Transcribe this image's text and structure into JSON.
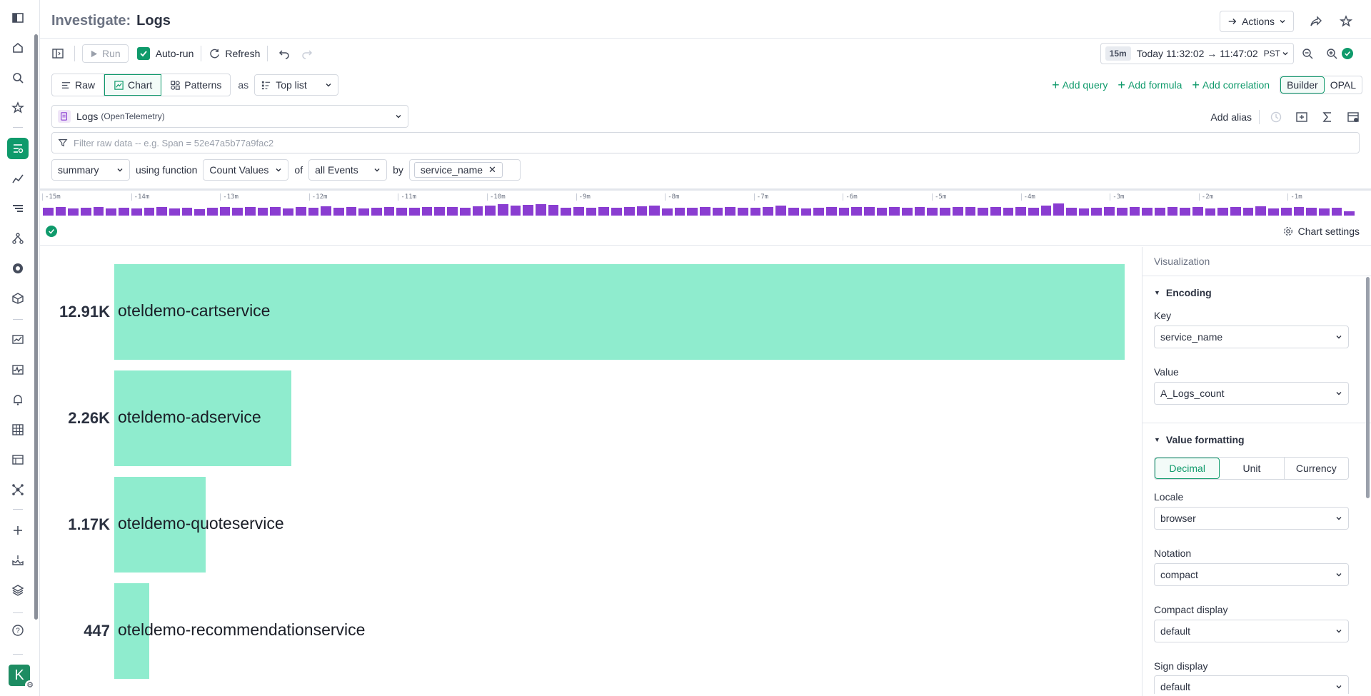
{
  "header": {
    "title_prefix": "Investigate:",
    "title": "Logs",
    "actions_label": "Actions"
  },
  "toolbar": {
    "run_label": "Run",
    "autorun_label": "Auto-run",
    "refresh_label": "Refresh",
    "time_chip": "15m",
    "time_range": "Today 11:32:02 → 11:47:02",
    "timezone": "PST"
  },
  "view_tabs": [
    {
      "label": "Raw"
    },
    {
      "label": "Chart"
    },
    {
      "label": "Patterns"
    }
  ],
  "as_label": "as",
  "display_select": "Top list",
  "query_actions": {
    "add_query": "Add query",
    "add_formula": "Add formula",
    "add_correlation": "Add correlation",
    "builder": "Builder",
    "opal": "OPAL"
  },
  "datasource": {
    "name": "Logs",
    "sub": "(OpenTelemetry)",
    "add_alias": "Add alias"
  },
  "filter": {
    "placeholder": "Filter raw data -- e.g. Span = 52e47a5b77a9fac2"
  },
  "builder": {
    "summary": "summary",
    "using_function": "using function",
    "function": "Count Values",
    "of": "of",
    "events": "all Events",
    "by": "by",
    "group_tag": "service_name"
  },
  "histogram": {
    "ticks": [
      "-15m",
      "-14m",
      "-13m",
      "-12m",
      "-11m",
      "-10m",
      "-9m",
      "-8m",
      "-7m",
      "-6m",
      "-5m",
      "-4m",
      "-3m",
      "-2m",
      "-1m"
    ],
    "values": [
      0.55,
      0.6,
      0.5,
      0.55,
      0.6,
      0.5,
      0.55,
      0.5,
      0.55,
      0.6,
      0.5,
      0.55,
      0.45,
      0.55,
      0.6,
      0.55,
      0.6,
      0.55,
      0.6,
      0.5,
      0.6,
      0.55,
      0.65,
      0.55,
      0.6,
      0.5,
      0.55,
      0.6,
      0.55,
      0.55,
      0.6,
      0.6,
      0.6,
      0.55,
      0.65,
      0.7,
      0.8,
      0.7,
      0.75,
      0.8,
      0.75,
      0.55,
      0.6,
      0.55,
      0.6,
      0.55,
      0.6,
      0.65,
      0.7,
      0.5,
      0.55,
      0.55,
      0.6,
      0.55,
      0.6,
      0.55,
      0.55,
      0.6,
      0.7,
      0.55,
      0.5,
      0.55,
      0.6,
      0.55,
      0.6,
      0.6,
      0.55,
      0.6,
      0.55,
      0.6,
      0.55,
      0.55,
      0.6,
      0.6,
      0.55,
      0.6,
      0.55,
      0.6,
      0.55,
      0.7,
      0.85,
      0.55,
      0.5,
      0.55,
      0.6,
      0.55,
      0.6,
      0.55,
      0.55,
      0.6,
      0.55,
      0.6,
      0.5,
      0.55,
      0.6,
      0.55,
      0.65,
      0.5,
      0.55,
      0.6,
      0.55,
      0.5,
      0.55,
      0.3
    ],
    "bar_color": "#8a3dd1"
  },
  "chart_settings_label": "Chart settings",
  "chart_data": {
    "type": "bar",
    "orientation": "horizontal",
    "categories": [
      "oteldemo-cartservice",
      "oteldemo-adservice",
      "oteldemo-quoteservice",
      "oteldemo-recommendationservice"
    ],
    "values": [
      12910,
      2260,
      1170,
      447
    ],
    "value_labels": [
      "12.91K",
      "2.26K",
      "1.17K",
      "447"
    ],
    "bar_color": "#8fecce"
  },
  "panel": {
    "title": "Visualization",
    "encoding": "Encoding",
    "key_label": "Key",
    "key_value": "service_name",
    "value_label": "Value",
    "value_value": "A_Logs_count",
    "value_formatting": "Value formatting",
    "fmt_tabs": [
      "Decimal",
      "Unit",
      "Currency"
    ],
    "locale_label": "Locale",
    "locale_value": "browser",
    "notation_label": "Notation",
    "notation_value": "compact",
    "compact_label": "Compact display",
    "compact_value": "default",
    "sign_label": "Sign display",
    "sign_value": "default"
  },
  "user": {
    "initial": "K"
  },
  "colors": {
    "accent": "#0f9a6b",
    "bar": "#8fecce",
    "histogram": "#8a3dd1"
  }
}
